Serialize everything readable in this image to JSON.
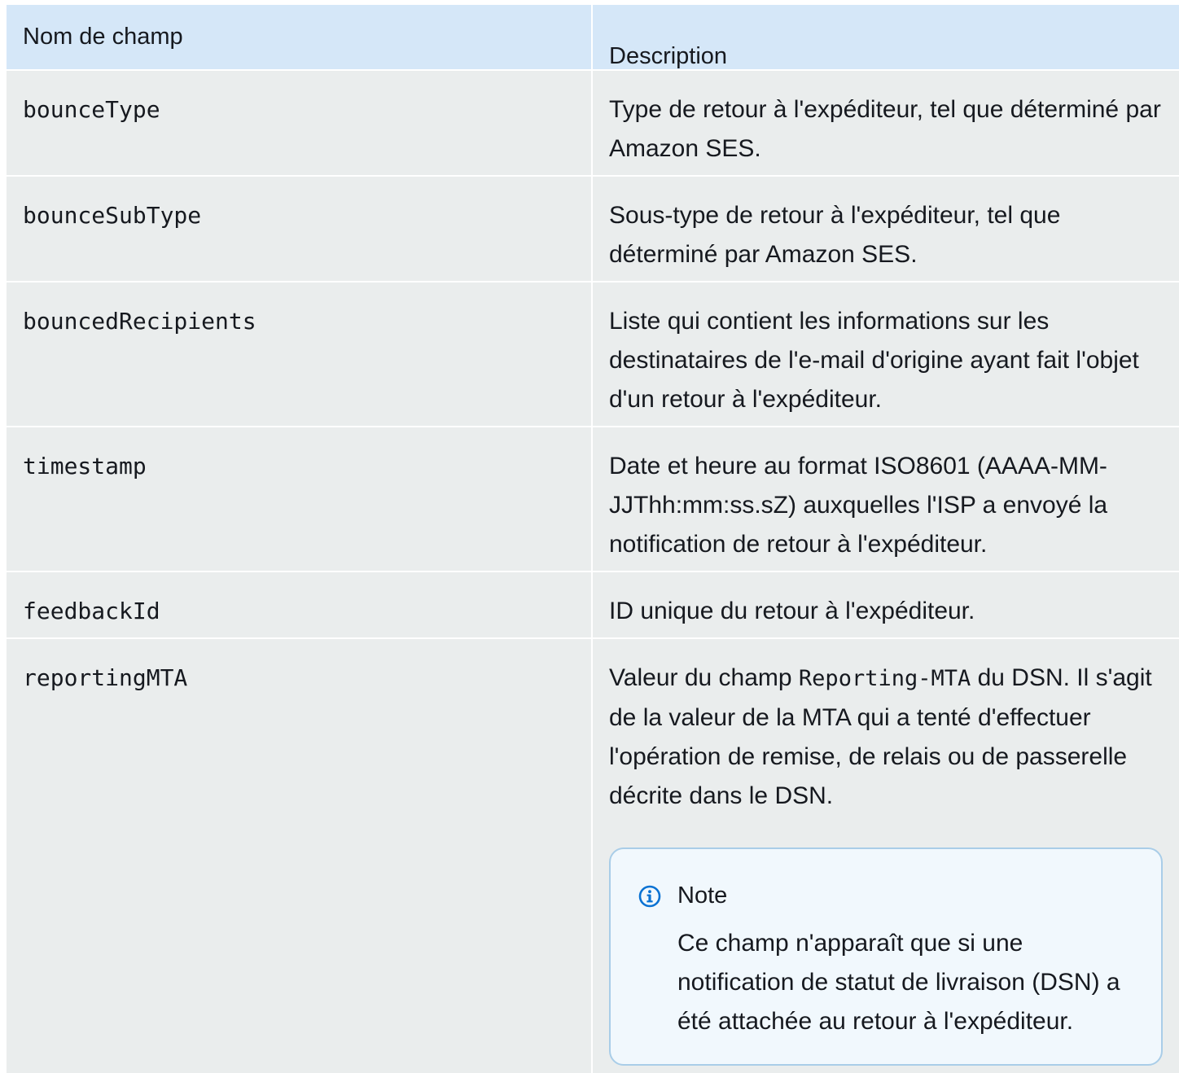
{
  "table": {
    "headers": [
      "Nom de champ",
      "Description"
    ],
    "rows": [
      {
        "field": "bounceType",
        "description": "Type de retour à l'expéditeur, tel que déterminé par Amazon SES."
      },
      {
        "field": "bounceSubType",
        "description": "Sous-type de retour à l'expéditeur, tel que déterminé par Amazon SES."
      },
      {
        "field": "bouncedRecipients",
        "description": "Liste qui contient les informations sur les destinataires de l'e-mail d'origine ayant fait l'objet d'un retour à l'expéditeur."
      },
      {
        "field": "timestamp",
        "description": "Date et heure au format ISO8601 (AAAA-MM-JJThh:mm:ss.sZ) auxquelles l'ISP a envoyé la notification de retour à l'expéditeur."
      },
      {
        "field": "feedbackId",
        "description": "ID unique du retour à l'expéditeur."
      },
      {
        "field": "reportingMTA",
        "description_before": "Valeur du champ ",
        "description_code": "Reporting-MTA",
        "description_after": " du DSN. Il s'agit de la valeur de la MTA qui a tenté d'effectuer l'opération de remise, de relais ou de passerelle décrite dans le DSN."
      }
    ]
  },
  "note": {
    "title": "Note",
    "body": "Ce champ n'apparaît que si une notification de statut de livraison (DSN) a été attachée au retour à l'expéditeur.",
    "icon": "info-icon",
    "accent": "#0972d3"
  }
}
